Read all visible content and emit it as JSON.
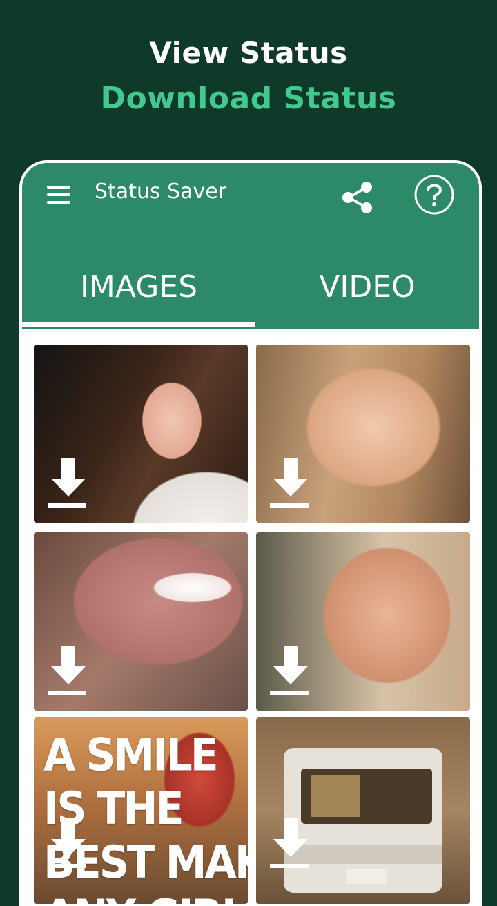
{
  "promo": {
    "line1": "View Status",
    "line2": "Download Status"
  },
  "app": {
    "title": "Status Saver",
    "icons": {
      "menu": "hamburger-menu-icon",
      "share": "share-icon",
      "help": "help-circle-icon"
    },
    "tabs": [
      {
        "label": "IMAGES",
        "selected": true
      },
      {
        "label": "VIDEO",
        "selected": false
      }
    ],
    "colors": {
      "background": "#0f3a2a",
      "appbar": "#2d8a69",
      "accent_text": "#43c98f"
    }
  },
  "grid": {
    "items": [
      {
        "kind": "photo",
        "icon": "download-icon"
      },
      {
        "kind": "photo",
        "icon": "download-icon"
      },
      {
        "kind": "photo",
        "icon": "download-icon"
      },
      {
        "kind": "photo",
        "icon": "download-icon"
      },
      {
        "kind": "quote-image",
        "icon": "download-icon",
        "text_lines": [
          "A SMILE",
          "IS THE",
          "BEST MAKEU",
          "ANY GIRL"
        ]
      },
      {
        "kind": "photo",
        "icon": "download-icon"
      }
    ]
  }
}
